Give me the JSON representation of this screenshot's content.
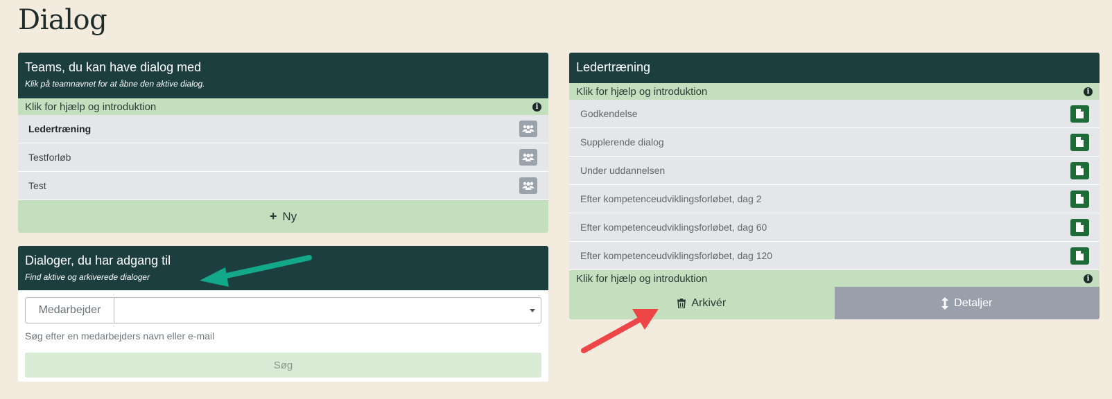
{
  "page": {
    "title": "Dialog"
  },
  "teams_panel": {
    "title": "Teams, du kan have dialog med",
    "subtitle": "Klik på teamnavnet for at åbne den aktive dialog.",
    "help": "Klik for hjælp og introduktion",
    "items": [
      {
        "label": "Ledertræning",
        "active": true
      },
      {
        "label": "Testforløb",
        "active": false
      },
      {
        "label": "Test",
        "active": false
      }
    ],
    "new_label": "Ny"
  },
  "dialogs_panel": {
    "title": "Dialoger, du har adgang til",
    "subtitle": "Find aktive og arkiverede dialoger",
    "employee_label": "Medarbejder",
    "employee_value": "",
    "hint": "Søg efter en medarbejders navn eller e-mail",
    "search_label": "Søg"
  },
  "detail_panel": {
    "title": "Ledertræning",
    "help_top": "Klik for hjælp og introduktion",
    "items": [
      {
        "label": "Godkendelse"
      },
      {
        "label": "Supplerende dialog"
      },
      {
        "label": "Under uddannelsen"
      },
      {
        "label": "Efter kompetenceudviklingsforløbet, dag 2"
      },
      {
        "label": "Efter kompetenceudviklingsforløbet, dag 60"
      },
      {
        "label": "Efter kompetenceudviklingsforløbet, dag 120"
      }
    ],
    "help_bottom": "Klik for hjælp og introduktion",
    "archive_label": "Arkivér",
    "details_label": "Detaljer"
  },
  "colors": {
    "background": "#f4ebdf",
    "header": "#1d3e3f",
    "help_bar": "#c4dfbd",
    "doc_button": "#1f6b38",
    "teal_arrow": "#14a88a",
    "red_arrow": "#ee4646"
  },
  "icons": {
    "info": "info-circle-icon",
    "team": "users-icon",
    "document": "file-icon",
    "trash": "trash-icon",
    "vertical_arrows": "arrows-vertical-icon",
    "plus": "plus-icon"
  }
}
